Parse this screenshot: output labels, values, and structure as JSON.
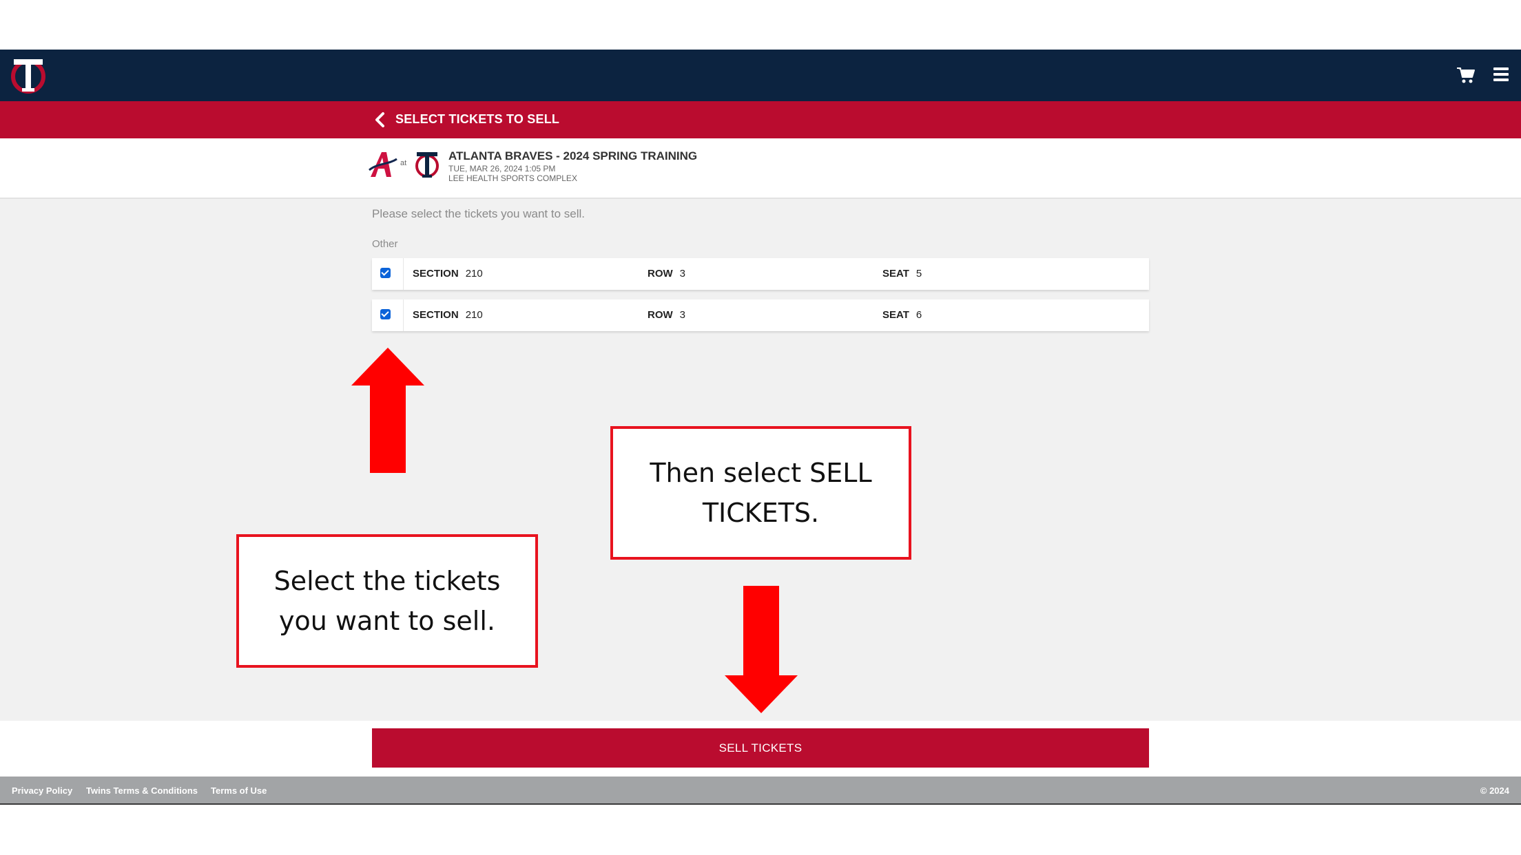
{
  "nav": {
    "logo_icon": "twins-tc-logo",
    "cart_icon": "shopping-cart-icon",
    "menu_icon": "hamburger-menu-icon",
    "bg_color": "#0c2340"
  },
  "titlebar": {
    "back_icon": "chevron-left-icon",
    "label": "SELECT TICKETS TO SELL",
    "bg_color": "#ba0c2f"
  },
  "event": {
    "away_logo": "braves-a-logo",
    "at_label": "at",
    "home_logo": "twins-tc-logo",
    "title": "ATLANTA BRAVES - 2024 SPRING TRAINING",
    "date": "TUE, MAR 26, 2024 1:05 PM",
    "venue": "LEE HEALTH SPORTS COMPLEX"
  },
  "main": {
    "instructions": "Please select the tickets you want to sell.",
    "group_label": "Other",
    "tickets": [
      {
        "checked": true,
        "section_label": "SECTION",
        "section": "210",
        "row_label": "ROW",
        "row": "3",
        "seat_label": "SEAT",
        "seat": "5"
      },
      {
        "checked": true,
        "section_label": "SECTION",
        "section": "210",
        "row_label": "ROW",
        "row": "3",
        "seat_label": "SEAT",
        "seat": "6"
      }
    ]
  },
  "annotations": {
    "callout_sell": "Then select SELL TICKETS.",
    "callout_select": "Select the tickets you want to sell.",
    "arrow_color": "#ff0000"
  },
  "action": {
    "sell_label": "SELL TICKETS"
  },
  "footer": {
    "links": [
      "Privacy Policy",
      "Twins Terms & Conditions",
      "Terms of Use"
    ],
    "copyright": "© 2024"
  }
}
